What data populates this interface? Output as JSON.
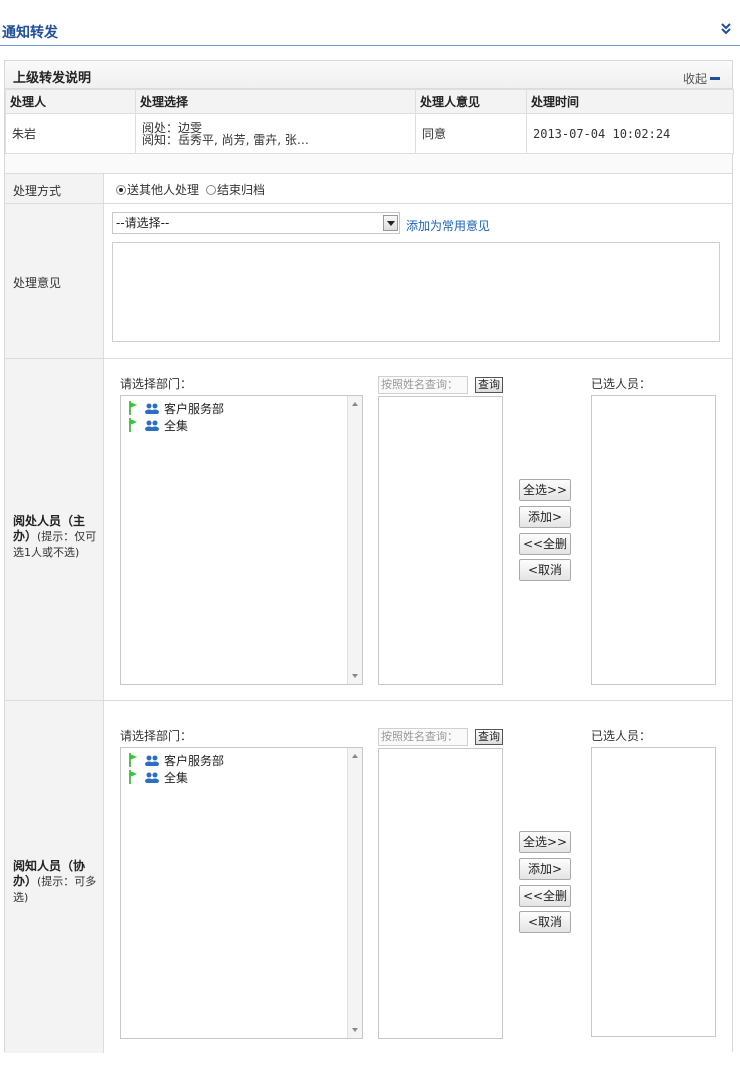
{
  "page": {
    "title": "通知转发",
    "chevron_icon": "double-chevron-down-icon",
    "accent": "#1f4f9a",
    "link_color": "#1a64b8"
  },
  "history": {
    "title": "上级转发说明",
    "collapse_label": "收起",
    "columns": [
      "处理人",
      "处理选择",
      "处理人意见",
      "处理时间"
    ],
    "rows": [
      {
        "handler": "朱岩",
        "choice_line1": "阅处：边雯",
        "choice_line2": "阅知：岳秀平, 尚芳, 雷卉, 张…",
        "opinion": "同意",
        "time": "2013-07-04 10:02:24"
      }
    ]
  },
  "form": {
    "method": {
      "label": "处理方式",
      "options": [
        "送其他人处理",
        "结束归档"
      ],
      "selected": "送其他人处理"
    },
    "opinion": {
      "label": "处理意见",
      "select_value": "--请选择--",
      "add_link": "添加为常用意见",
      "text": ""
    },
    "primary": {
      "label_bold": "阅处人员（主办）",
      "label_hint": "(提示：仅可选1人或不选)",
      "dept_label": "请选择部门：",
      "depts": [
        "客户服务部",
        "全集"
      ],
      "search_placeholder": "按照姓名查询：",
      "query_btn": "查询",
      "selected_label": "已选人员：",
      "buttons": [
        "全选>>",
        "添加>",
        "<<全删",
        "<取消"
      ]
    },
    "secondary": {
      "label_bold": "阅知人员（协办）",
      "label_hint": "(提示：可多选)",
      "dept_label": "请选择部门：",
      "depts": [
        "客户服务部",
        "全集"
      ],
      "search_placeholder": "按照姓名查询：",
      "query_btn": "查询",
      "selected_label": "已选人员：",
      "buttons": [
        "全选>>",
        "添加>",
        "<<全删",
        "<取消"
      ]
    }
  }
}
